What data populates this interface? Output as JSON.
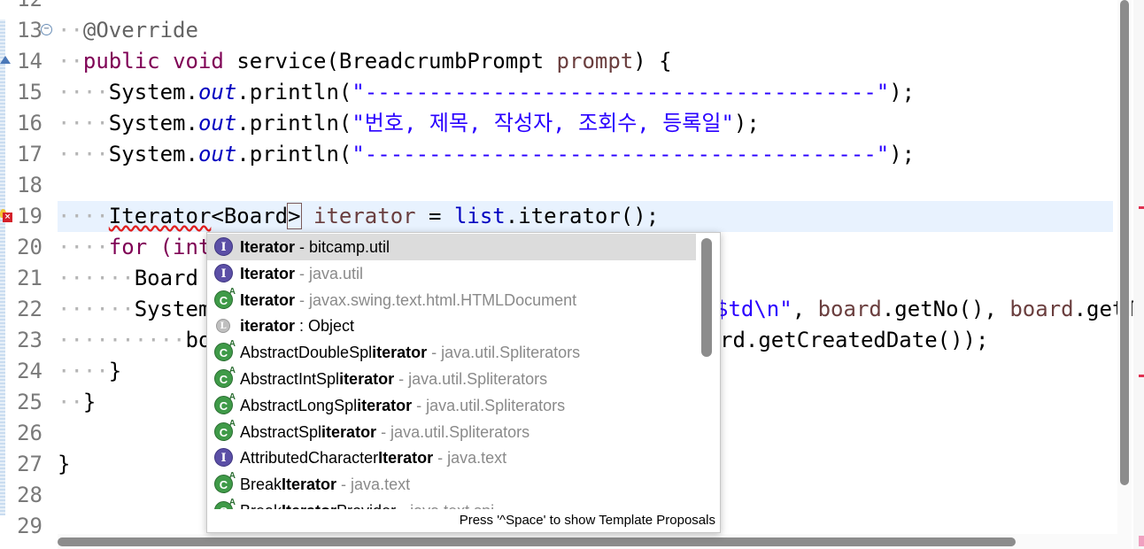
{
  "editor": {
    "lines": [
      {
        "n": "12"
      },
      {
        "n": "13"
      },
      {
        "n": "14"
      },
      {
        "n": "15"
      },
      {
        "n": "16"
      },
      {
        "n": "17"
      },
      {
        "n": "18"
      },
      {
        "n": "19"
      },
      {
        "n": "20"
      },
      {
        "n": "21"
      },
      {
        "n": "22"
      },
      {
        "n": "23"
      },
      {
        "n": "24"
      },
      {
        "n": "25"
      },
      {
        "n": "26"
      },
      {
        "n": "27"
      },
      {
        "n": "28"
      },
      {
        "n": "29"
      }
    ],
    "code": {
      "l13_ann": "@Override",
      "l14_public": "public",
      "l14_void": "void",
      "l14_rest1": "service(BreadcrumbPrompt",
      "l14_param": "prompt",
      "l14_rest2": ") {",
      "sys": "System.",
      "out": "out",
      "println": ".println(",
      "dashes": "\"----------------------------------------\"",
      "end": ");",
      "l16_str": "\"번호, 제목, 작성자, 조회수, 등록일\"",
      "l19_type": "Iterator",
      "l19_generic_open": "<Board",
      "l19_generic_close": ">",
      "l19_var": "iterator",
      "l19_eq": " = ",
      "l19_list": "list",
      "l19_call": ".iterator();",
      "l20_for": "for",
      "l20_rest": " (int",
      "l21_text": "Board",
      "l22_text": "System",
      "l22_tail_str": "$td\\n\"",
      "l22_tail_rest1": ", ",
      "l22_board1": "board",
      "l22_tail_rest2": ".getNo(), ",
      "l22_board2": "board",
      "l22_tail_rest3": ".getT",
      "l23_head": "bo",
      "l23_tail": "rd.getCreatedDate());",
      "brace_close": "}"
    }
  },
  "completion": {
    "items": [
      {
        "icon": "interface-icon",
        "glyph": "I",
        "name_bold": "Iterator",
        "name_pre": "",
        "name_post": "",
        "qualifier": " - bitcamp.util",
        "qual_dark": true
      },
      {
        "icon": "interface-icon",
        "glyph": "I",
        "name_bold": "Iterator",
        "name_pre": "",
        "name_post": "",
        "qualifier": " - java.util",
        "qual_dark": false
      },
      {
        "icon": "abstract-class-icon",
        "glyph": "C",
        "name_bold": "Iterator",
        "name_pre": "",
        "name_post": "",
        "qualifier": " - javax.swing.text.html.HTMLDocument",
        "qual_dark": false
      },
      {
        "icon": "local-variable-icon",
        "glyph": "L",
        "name_bold": "iterator",
        "name_pre": "",
        "name_post": "",
        "qualifier": " : Object",
        "qual_dark": true
      },
      {
        "icon": "abstract-class-icon",
        "glyph": "C",
        "name_bold": "iterator",
        "name_pre": "AbstractDoubleSpl",
        "name_post": "",
        "qualifier": " - java.util.Spliterators",
        "qual_dark": false
      },
      {
        "icon": "abstract-class-icon",
        "glyph": "C",
        "name_bold": "iterator",
        "name_pre": "AbstractIntSpl",
        "name_post": "",
        "qualifier": " - java.util.Spliterators",
        "qual_dark": false
      },
      {
        "icon": "abstract-class-icon",
        "glyph": "C",
        "name_bold": "iterator",
        "name_pre": "AbstractLongSpl",
        "name_post": "",
        "qualifier": " - java.util.Spliterators",
        "qual_dark": false
      },
      {
        "icon": "abstract-class-icon",
        "glyph": "C",
        "name_bold": "iterator",
        "name_pre": "AbstractSpl",
        "name_post": "",
        "qualifier": " - java.util.Spliterators",
        "qual_dark": false
      },
      {
        "icon": "interface-icon",
        "glyph": "I",
        "name_bold": "Iterator",
        "name_pre": "AttributedCharacter",
        "name_post": "",
        "qualifier": " - java.text",
        "qual_dark": false
      },
      {
        "icon": "abstract-class-icon",
        "glyph": "C",
        "name_bold": "Iterator",
        "name_pre": "Break",
        "name_post": "",
        "qualifier": " - java.text",
        "qual_dark": false
      },
      {
        "icon": "abstract-class-icon",
        "glyph": "C",
        "name_bold": "Iterator",
        "name_pre": "Break",
        "name_post": "Provider",
        "qualifier": " - java.text.spi",
        "qual_dark": false
      }
    ],
    "abstract_marker": "A",
    "status_text": "Press '^Space' to show Template Proposals"
  }
}
